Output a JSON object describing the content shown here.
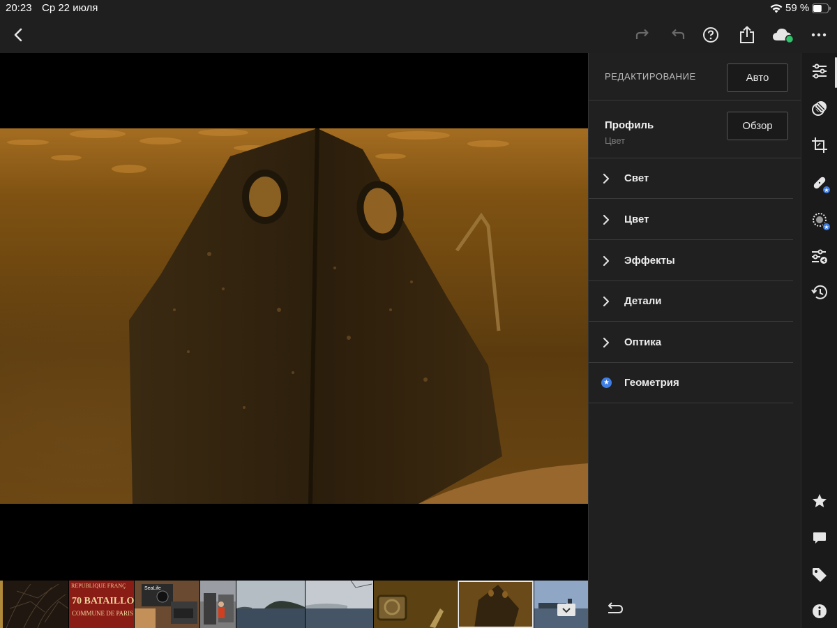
{
  "status_bar": {
    "time": "20:23",
    "date": "Ср 22 июля",
    "battery_percent": "59 %",
    "battery_level": 0.59
  },
  "toolbar": {
    "icons": [
      "back-icon",
      "redo-icon",
      "undo-icon",
      "help-icon",
      "share-icon",
      "cloud-sync-icon",
      "more-icon"
    ],
    "cloud_status_color": "#2fc26b"
  },
  "panel": {
    "title": "РЕДАКТИРОВАНИЕ",
    "auto_label": "Авто",
    "profile": {
      "label": "Профиль",
      "value": "Цвет",
      "browse_label": "Обзор"
    },
    "sections": [
      {
        "label": "Свет",
        "icon": "chevron-right-icon"
      },
      {
        "label": "Цвет",
        "icon": "chevron-right-icon"
      },
      {
        "label": "Эффекты",
        "icon": "chevron-right-icon"
      },
      {
        "label": "Детали",
        "icon": "chevron-right-icon"
      },
      {
        "label": "Оптика",
        "icon": "chevron-right-icon"
      },
      {
        "label": "Геометрия",
        "icon": "premium-star-icon"
      }
    ],
    "reset_icon": "reset-icon"
  },
  "rail": {
    "tools": [
      "edit-sliders-icon",
      "masking-icon",
      "crop-icon",
      "healing-icon",
      "selective-icon",
      "presets-icon",
      "history-icon"
    ],
    "bottom": [
      "rating-star-icon",
      "comment-icon",
      "tag-icon",
      "info-icon"
    ],
    "accent_color": "#3f7fe3"
  },
  "photo": {
    "subject": "underwater-shipwreck-photo"
  },
  "filmstrip": {
    "thumbnails": [
      {
        "name": "thumb-branches"
      },
      {
        "name": "thumb-sign",
        "text_line1": "REPUBLIQUE FRANÇ",
        "text_line2": "70 BATAILLO",
        "text_line3": "COMMUNE DE PARIS"
      },
      {
        "name": "thumb-electronics",
        "text": "SeaLife"
      },
      {
        "name": "thumb-person"
      },
      {
        "name": "thumb-sea-island"
      },
      {
        "name": "thumb-sea-fog"
      },
      {
        "name": "thumb-underwater-machine"
      },
      {
        "name": "thumb-shipwreck-selected"
      },
      {
        "name": "thumb-lake-town"
      }
    ]
  }
}
